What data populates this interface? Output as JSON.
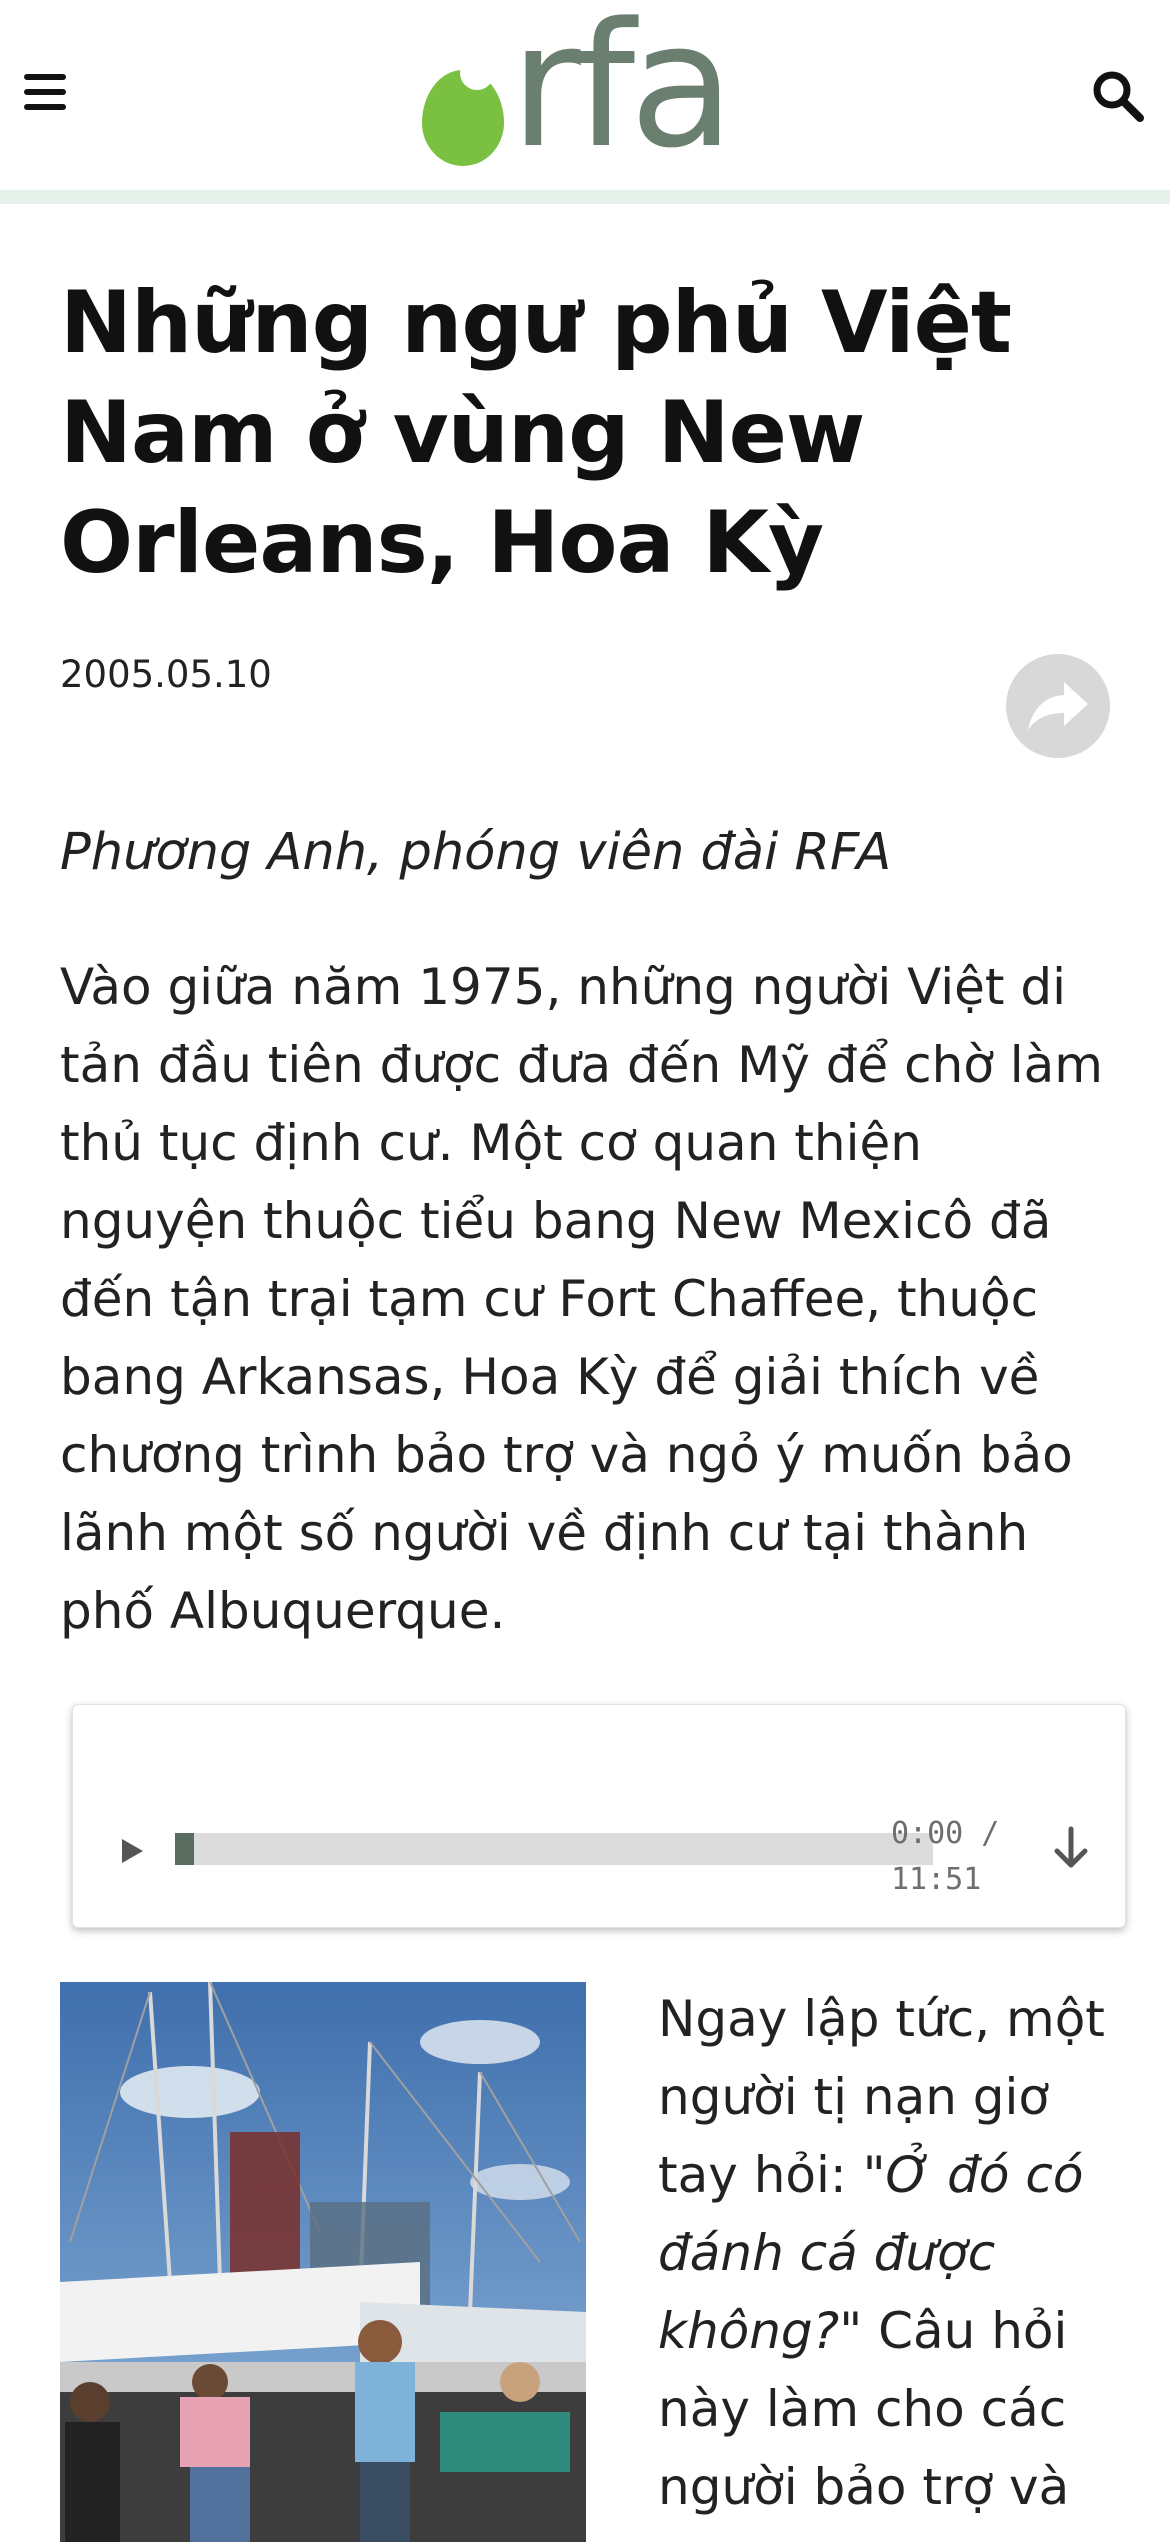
{
  "header": {
    "logo_text": "rfa",
    "menu_icon": "hamburger-menu-icon",
    "search_icon": "search-icon",
    "brand_colors": {
      "logo_green": "#7ac142",
      "logo_gray": "#6b7f70",
      "stripe": "#e6f1ec"
    }
  },
  "article": {
    "title": "Những ngư phủ Việt Nam ở vùng New Orleans, Hoa Kỳ",
    "date": "2005.05.10",
    "share_icon": "share-icon",
    "byline": "Phương Anh, phóng viên đài RFA",
    "paragraph1": "Vào giữa năm 1975, những người Việt di tản đầu tiên được đưa đến Mỹ để chờ làm thủ tục định cư. Một cơ quan thiện nguyện thuộc tiểu bang New Mexicô đã đến tận trại tạm cư Fort Chaffee, thuộc bang Arkansas, Hoa Kỳ để giải thích về chương trình bảo trợ và ngỏ ý muốn bảo lãnh một số người về định cư tại thành phố Albuquerque.",
    "paragraph2_start": "Ngay lập tức, một người tị nạn giơ tay hỏi: ",
    "paragraph2_quote": "\"Ở đó có đánh cá được không?\"",
    "paragraph2_rest": " Câu hỏi này làm cho các người bảo trợ và"
  },
  "audio_player": {
    "current_time": "0:00",
    "separator": " /",
    "duration": "11:51",
    "progress_fraction": 0.025,
    "play_icon": "play-icon",
    "download_icon": "download-arrow-icon"
  },
  "photo": {
    "description_icon": "fishing-boat-photo"
  }
}
